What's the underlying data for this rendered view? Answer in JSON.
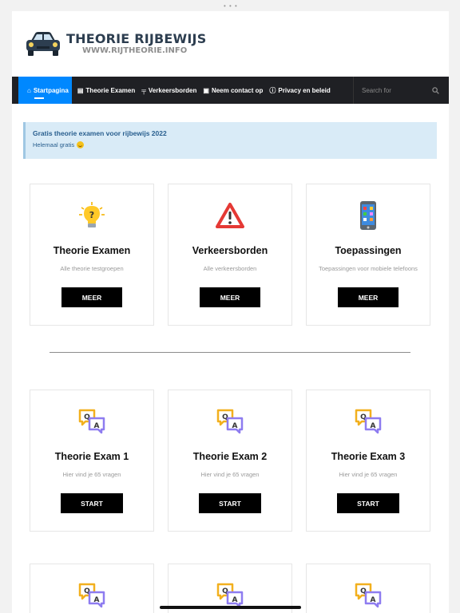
{
  "brand": {
    "title": "THEORIE RIJBEWIJS",
    "subtitle": "WWW.RIJTHEORIE.INFO"
  },
  "nav": {
    "items": [
      {
        "icon": "home-icon",
        "label": "Startpagina",
        "active": true
      },
      {
        "icon": "document-icon",
        "label": "Theorie Examen"
      },
      {
        "icon": "signpost-icon",
        "label": "Verkeersborden"
      },
      {
        "icon": "contact-card-icon",
        "label": "Neem contact op"
      },
      {
        "icon": "info-icon",
        "label": "Privacy en beleid"
      }
    ],
    "search_placeholder": "Search for"
  },
  "notice": {
    "title": "Gratis theorie examen voor rijbewijs 2022",
    "text": "Helemaal gratis"
  },
  "feature_cards": [
    {
      "icon": "lightbulb-icon",
      "title": "Theorie Examen",
      "desc": "Alle theorie testgroepen",
      "button": "MEER"
    },
    {
      "icon": "warning-sign-icon",
      "title": "Verkeersborden",
      "desc": "Alle verkeersborden",
      "button": "MEER"
    },
    {
      "icon": "smartphone-icon",
      "title": "Toepassingen",
      "desc": "Toepassingen voor mobiele telefoons",
      "button": "MEER"
    }
  ],
  "exam_cards": [
    {
      "icon": "qa-icon",
      "title": "Theorie Exam 1",
      "desc": "Hier vind je 65 vragen",
      "button": "START"
    },
    {
      "icon": "qa-icon",
      "title": "Theorie Exam 2",
      "desc": "Hier vind je 65 vragen",
      "button": "START"
    },
    {
      "icon": "qa-icon",
      "title": "Theorie Exam 3",
      "desc": "Hier vind je 65 vragen",
      "button": "START"
    }
  ],
  "colors": {
    "nav_bg": "#1f2024",
    "nav_active": "#0088ff",
    "notice_bg": "#d9ebf7",
    "button_bg": "#000000"
  }
}
